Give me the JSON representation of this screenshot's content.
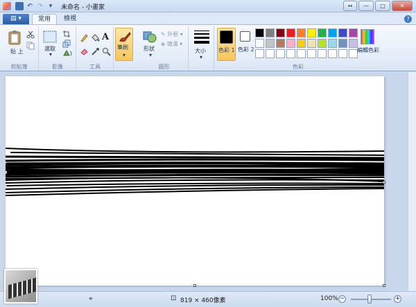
{
  "window": {
    "title": "未命名 - 小畫家",
    "controls": {
      "arrows": "↔",
      "minimize": "—",
      "maximize": "□",
      "close": "✕"
    }
  },
  "menu_button": "▤ ▾",
  "tabs": [
    {
      "label": "常用",
      "active": true
    },
    {
      "label": "檢視",
      "active": false
    }
  ],
  "help": "?",
  "ribbon": {
    "clipboard": {
      "label": "剪貼簿",
      "paste": "貼\n上"
    },
    "image": {
      "label": "影像",
      "select": "選取"
    },
    "tools": {
      "label": "工具",
      "text_icon": "A"
    },
    "brushes": {
      "label": "筆刷"
    },
    "shapes": {
      "label": "圖形",
      "shapes_btn": "形狀",
      "outline": "外框",
      "fill": "填滿"
    },
    "size": {
      "label": "大小"
    },
    "colors": {
      "label": "色彩",
      "color1": "色彩 1",
      "color2": "色彩 2",
      "edit_colors": "編輯色彩",
      "color1_value": "#000000",
      "color2_value": "#ffffff",
      "palette": [
        "#000000",
        "#7f7f7f",
        "#880015",
        "#ed1c24",
        "#ff7f27",
        "#fff200",
        "#22b14c",
        "#00a2e8",
        "#3f48cc",
        "#a349a4",
        "#ffffff",
        "#c3c3c3",
        "#b97a57",
        "#ffaec9",
        "#ffc90e",
        "#efe4b0",
        "#b5e61d",
        "#99d9ea",
        "#7092be",
        "#c8bfe7",
        "#ffffff",
        "#ffffff",
        "#ffffff",
        "#ffffff",
        "#ffffff",
        "#ffffff",
        "#ffffff",
        "#ffffff",
        "#ffffff",
        "#ffffff"
      ]
    }
  },
  "status": {
    "dimensions": "819 × 460像素",
    "zoom": "100%"
  }
}
